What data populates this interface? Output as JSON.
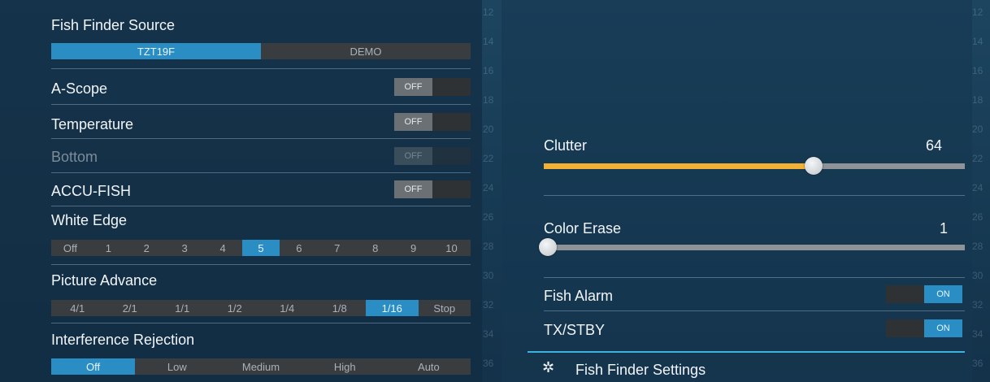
{
  "left_panel": {
    "fish_finder_source": {
      "label": "Fish Finder Source",
      "options": [
        "TZT19F",
        "DEMO"
      ],
      "selected": "TZT19F"
    },
    "a_scope": {
      "label": "A-Scope",
      "toggle": "OFF"
    },
    "temperature": {
      "label": "Temperature",
      "toggle": "OFF"
    },
    "bottom": {
      "label": "Bottom",
      "toggle": "OFF",
      "disabled": true
    },
    "accu_fish": {
      "label": "ACCU-FISH",
      "toggle": "OFF"
    },
    "white_edge": {
      "label": "White Edge",
      "options": [
        "Off",
        "1",
        "2",
        "3",
        "4",
        "5",
        "6",
        "7",
        "8",
        "9",
        "10"
      ],
      "selected": "5"
    },
    "picture_advance": {
      "label": "Picture Advance",
      "options": [
        "4/1",
        "2/1",
        "1/1",
        "1/2",
        "1/4",
        "1/8",
        "1/16",
        "Stop"
      ],
      "selected": "1/16"
    },
    "interference_rejection": {
      "label": "Interference Rejection",
      "options": [
        "Off",
        "Low",
        "Medium",
        "High",
        "Auto"
      ],
      "selected": "Off"
    }
  },
  "right_panel": {
    "clutter": {
      "label": "Clutter",
      "value": "64",
      "level": 64,
      "max": 100
    },
    "color_erase": {
      "label": "Color Erase",
      "value": "1",
      "level": 1,
      "max": 100
    },
    "fish_alarm": {
      "label": "Fish Alarm",
      "toggle": "ON"
    },
    "tx_stby": {
      "label": "TX/STBY",
      "toggle": "ON"
    },
    "settings": {
      "label": "Fish Finder Settings",
      "icon": "gear-icon"
    }
  },
  "depth_scale": [
    "12",
    "14",
    "16",
    "18",
    "20",
    "22",
    "24",
    "26",
    "28",
    "30",
    "32",
    "34",
    "36"
  ],
  "colors": {
    "accent": "#2a8dc4",
    "slider": "#f2b134"
  }
}
